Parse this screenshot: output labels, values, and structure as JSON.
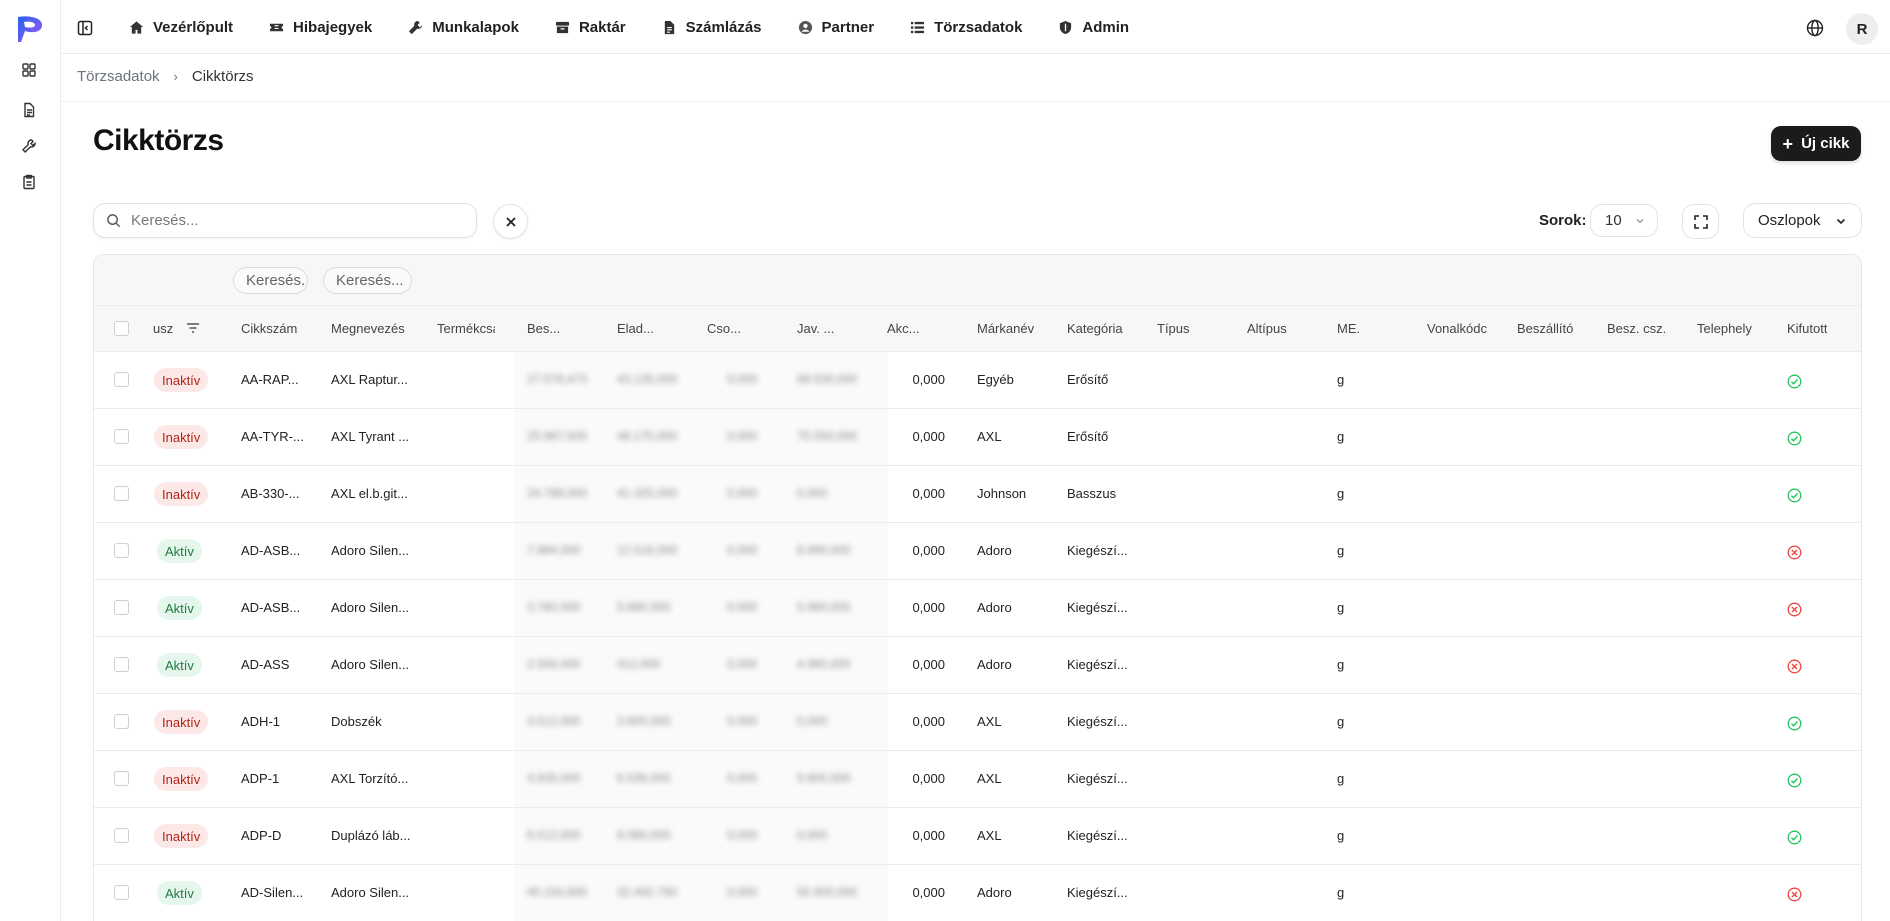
{
  "nav": {
    "items": [
      {
        "label": "Vezérlőpult",
        "icon": "home-icon"
      },
      {
        "label": "Hibajegyek",
        "icon": "ticket-icon"
      },
      {
        "label": "Munkalapok",
        "icon": "wrench-icon"
      },
      {
        "label": "Raktár",
        "icon": "archive-icon"
      },
      {
        "label": "Számlázás",
        "icon": "document-icon"
      },
      {
        "label": "Partner",
        "icon": "user-circle-icon"
      },
      {
        "label": "Törzsadatok",
        "icon": "list-icon"
      },
      {
        "label": "Admin",
        "icon": "shield-icon"
      }
    ],
    "avatar_initial": "R"
  },
  "breadcrumb": {
    "parent": "Törzsadatok",
    "current": "Cikktörzs"
  },
  "page": {
    "title": "Cikktörzs",
    "new_button": "Új cikk"
  },
  "toolbar": {
    "search_placeholder": "Keresés...",
    "rows_label": "Sorok:",
    "rows_value": "10",
    "columns_label": "Oszlopok"
  },
  "filters": {
    "pill1": "Keresés...",
    "pill2": "Keresés..."
  },
  "columns": [
    "usz",
    "Cikkszám",
    "Megnevezés",
    "Termékcsa",
    "Bes...",
    "Elad...",
    "Cso...",
    "Jav. ...",
    "Akc...",
    "Márkanév",
    "Kategória",
    "Típus",
    "Altípus",
    "ME.",
    "Vonalkódc",
    "Beszállító",
    "Besz. csz.",
    "Telephely",
    "Kifutott"
  ],
  "rows": [
    {
      "status": "Inaktív",
      "sku": "AA-RAP...",
      "name": "AXL Raptur...",
      "b1": "27.578,473",
      "b2": "43.135,000",
      "b3": "0,000",
      "b4": "69.530,000",
      "akc": "0,000",
      "brand": "Egyéb",
      "cat": "Erősítő",
      "me": "g",
      "kifutott": "ok"
    },
    {
      "status": "Inaktív",
      "sku": "AA-TYR-...",
      "name": "AXL Tyrant ...",
      "b1": "25.967,500",
      "b2": "48.175,000",
      "b3": "0,000",
      "b4": "75.550,000",
      "akc": "0,000",
      "brand": "AXL",
      "cat": "Erősítő",
      "me": "g",
      "kifutott": "ok"
    },
    {
      "status": "Inaktív",
      "sku": "AB-330-...",
      "name": "AXL el.b.git...",
      "b1": "24.788,000",
      "b2": "41.325,000",
      "b3": "0,000",
      "b4": "0,000",
      "akc": "0,000",
      "brand": "Johnson",
      "cat": "Basszus",
      "me": "g",
      "kifutott": "ok"
    },
    {
      "status": "Aktív",
      "sku": "AD-ASB...",
      "name": "Adoro Silen...",
      "b1": "7.884,000",
      "b2": "12.516,000",
      "b3": "0,000",
      "b4": "8.990,000",
      "akc": "0,000",
      "brand": "Adoro",
      "cat": "Kiegészí...",
      "me": "g",
      "kifutott": "no"
    },
    {
      "status": "Aktív",
      "sku": "AD-ASB...",
      "name": "Adoro Silen...",
      "b1": "3.780,000",
      "b2": "5.680,000",
      "b3": "0,000",
      "b4": "5.990,000",
      "akc": "0,000",
      "brand": "Adoro",
      "cat": "Kiegészí...",
      "me": "g",
      "kifutott": "no"
    },
    {
      "status": "Aktív",
      "sku": "AD-ASS",
      "name": "Adoro Silen...",
      "b1": "2.556,000",
      "b2": "412,000",
      "b3": "0,000",
      "b4": "4.990,000",
      "akc": "0,000",
      "brand": "Adoro",
      "cat": "Kiegészí...",
      "me": "g",
      "kifutott": "no"
    },
    {
      "status": "Inaktív",
      "sku": "ADH-1",
      "name": "Dobszék",
      "b1": "3.512,000",
      "b2": "3.800,000",
      "b3": "0,000",
      "b4": "0,000",
      "akc": "0,000",
      "brand": "AXL",
      "cat": "Kiegészí...",
      "me": "g",
      "kifutott": "ok"
    },
    {
      "status": "Inaktív",
      "sku": "ADP-1",
      "name": "AXL Torzító...",
      "b1": "4.835,000",
      "b2": "6.536,000",
      "b3": "0,000",
      "b4": "9.900,000",
      "akc": "0,000",
      "brand": "AXL",
      "cat": "Kiegészí...",
      "me": "g",
      "kifutott": "ok"
    },
    {
      "status": "Inaktív",
      "sku": "ADP-D",
      "name": "Duplázó láb...",
      "b1": "6.512,000",
      "b2": "8.080,000",
      "b3": "0,000",
      "b4": "0,000",
      "akc": "0,000",
      "brand": "AXL",
      "cat": "Kiegészí...",
      "me": "g",
      "kifutott": "ok"
    },
    {
      "status": "Aktív",
      "sku": "AD-Silen...",
      "name": "Adoro Silen...",
      "b1": "45.154,800",
      "b2": "32.492,760",
      "b3": "0,000",
      "b4": "55.900,000",
      "akc": "0,000",
      "brand": "Adoro",
      "cat": "Kiegészí...",
      "me": "g",
      "kifutott": "no"
    }
  ],
  "colors": {
    "accent": "#7c3aed",
    "ok": "#22c55e",
    "no": "#ef4444"
  }
}
